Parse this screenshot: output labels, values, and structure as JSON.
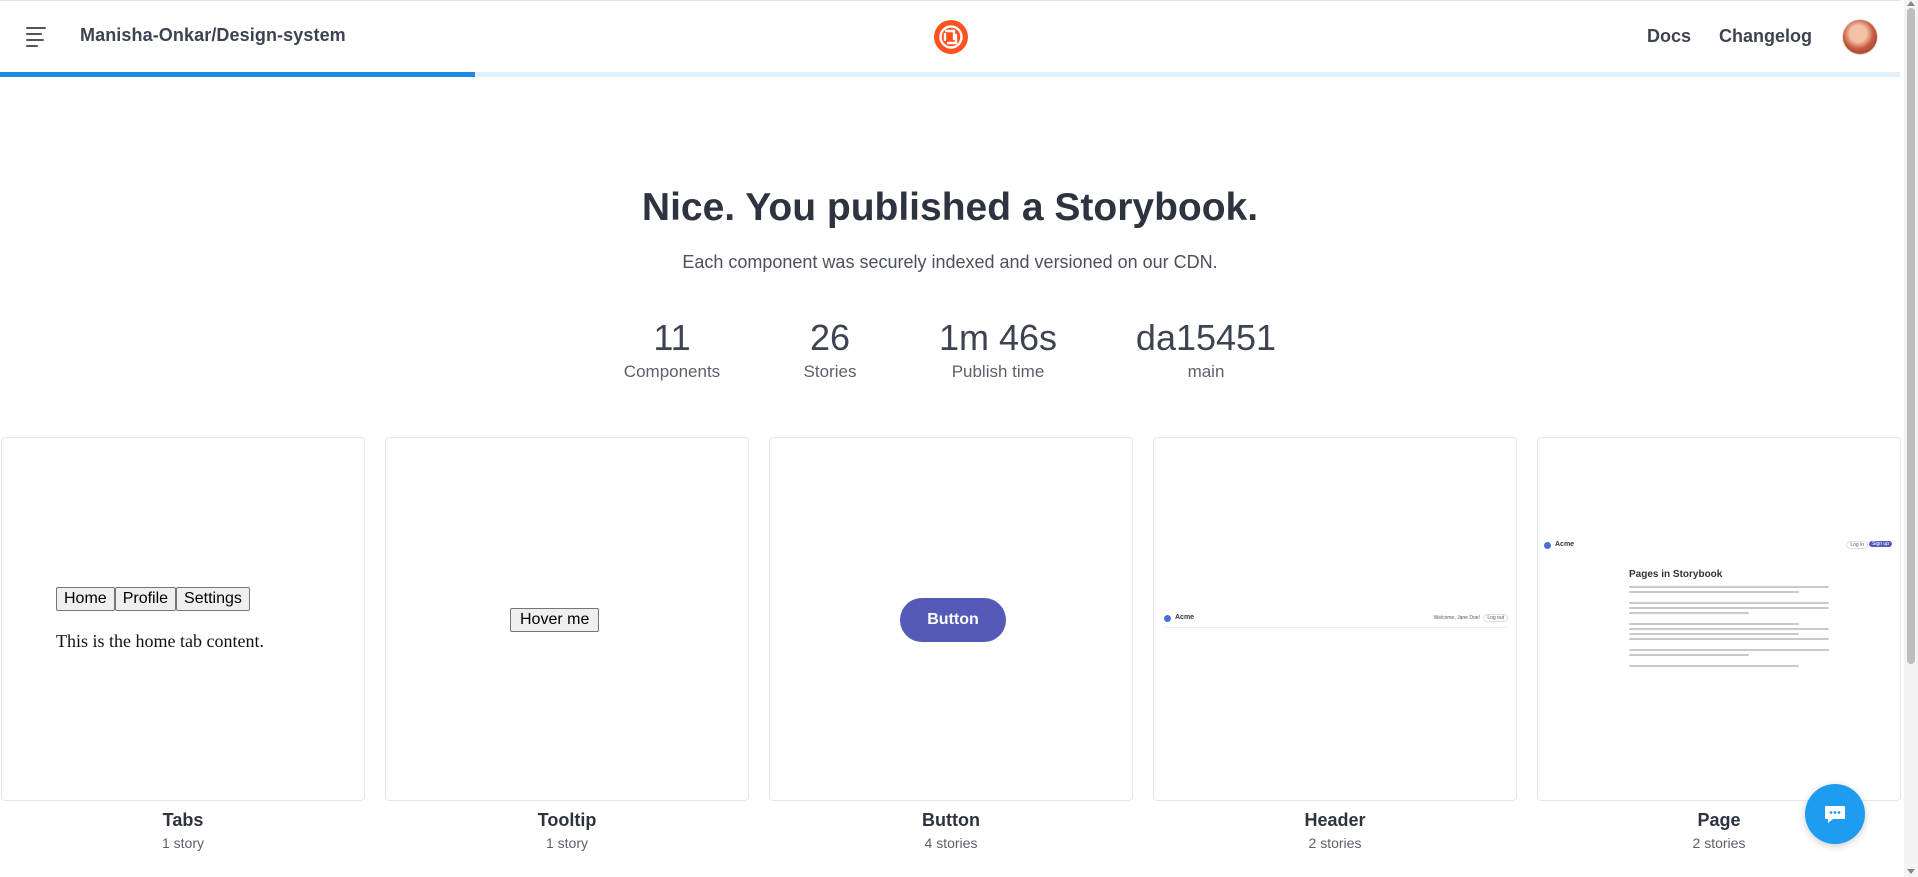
{
  "header": {
    "repo": "Manisha-Onkar/Design-system",
    "nav": {
      "docs": "Docs",
      "changelog": "Changelog"
    },
    "menu_icon": "hamburger-menu-icon",
    "logo_icon": "chromatic-logo-icon",
    "progress": 0.25,
    "colors": {
      "logo": "#fc521f",
      "progress": "#1e8ae5",
      "progress_track": "#e3f1fd"
    }
  },
  "hero": {
    "title": "Nice. You published a Storybook.",
    "subtitle": "Each component was securely indexed and versioned on our CDN."
  },
  "stats": [
    {
      "value": "11",
      "label": "Components"
    },
    {
      "value": "26",
      "label": "Stories"
    },
    {
      "value": "1m 46s",
      "label": "Publish time"
    },
    {
      "value": "da15451",
      "label": "main"
    }
  ],
  "components": [
    {
      "name": "Tabs",
      "count": "1 story",
      "preview": {
        "tabs": [
          "Home",
          "Profile",
          "Settings"
        ],
        "content": "This is the home tab content."
      }
    },
    {
      "name": "Tooltip",
      "count": "1 story",
      "preview": {
        "button": "Hover me"
      }
    },
    {
      "name": "Button",
      "count": "4 stories",
      "preview": {
        "button": "Button",
        "color": "#555ab9"
      }
    },
    {
      "name": "Header",
      "count": "2 stories",
      "preview": {
        "title": "Acme",
        "welcome": "Welcome, Jane Doe!",
        "logout": "Log out"
      }
    },
    {
      "name": "Page",
      "count": "2 stories",
      "preview": {
        "title": "Acme",
        "login": "Log in",
        "signup": "Sign up",
        "heading": "Pages in Storybook"
      }
    }
  ],
  "chat": {
    "icon": "chat-bubble-icon",
    "color": "#1e9cf0"
  }
}
